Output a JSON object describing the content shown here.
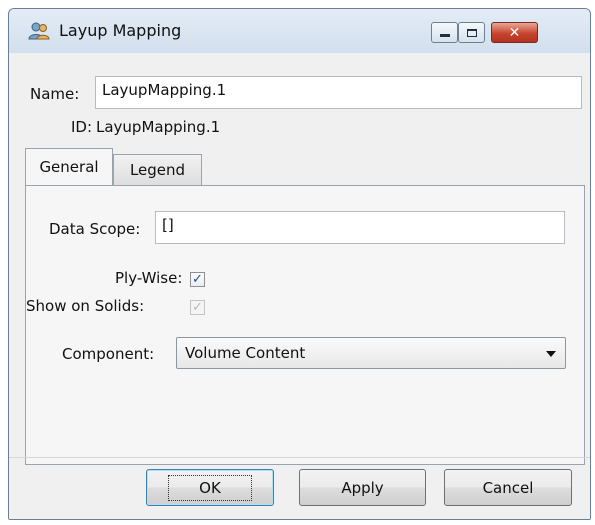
{
  "window": {
    "title": "Layup Mapping",
    "app_icon": "users-icon",
    "controls": {
      "minimize": "minimize-icon",
      "maximize": "maximize-icon",
      "close_glyph": "✕"
    }
  },
  "form": {
    "name_label": "Name:",
    "name_value": "LayupMapping.1",
    "id_label": "ID:",
    "id_value": "LayupMapping.1"
  },
  "tabs": [
    {
      "label": "General",
      "active": true
    },
    {
      "label": "Legend",
      "active": false
    }
  ],
  "general": {
    "data_scope_label": "Data Scope:",
    "data_scope_value": "[]",
    "ply_wise_label": "Ply-Wise:",
    "ply_wise_checked": true,
    "show_on_solids_label": "Show on Solids:",
    "show_on_solids_checked": true,
    "show_on_solids_enabled": false,
    "component_label": "Component:",
    "component_value": "Volume Content"
  },
  "buttons": {
    "ok": "OK",
    "apply": "Apply",
    "cancel": "Cancel"
  },
  "colors": {
    "titlebar": "#d8e4f0",
    "close_button": "#c7452e",
    "check_mark": "#2a4f87"
  }
}
